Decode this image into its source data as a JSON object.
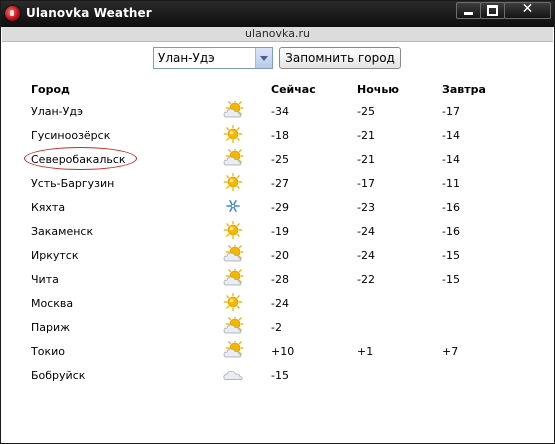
{
  "window": {
    "title": "Ulanovka Weather"
  },
  "url": "ulanovka.ru",
  "controls": {
    "city_select": {
      "value": "Улан-Удэ"
    },
    "remember_button": "Запомнить город"
  },
  "table": {
    "headers": {
      "city": "Город",
      "now": "Сейчас",
      "night": "Ночью",
      "tomorrow": "Завтра"
    },
    "rows": [
      {
        "city": "Улан-Удэ",
        "icon": "partly-cloudy-icon",
        "now": "-34",
        "night": "-25",
        "tomorrow": "-17"
      },
      {
        "city": "Гусиноозёрск",
        "icon": "sun-icon",
        "now": "-18",
        "night": "-21",
        "tomorrow": "-14"
      },
      {
        "city": "Северобакальск",
        "icon": "partly-cloudy-icon",
        "now": "-25",
        "night": "-21",
        "tomorrow": "-14",
        "highlighted": true
      },
      {
        "city": "Усть-Баргузин",
        "icon": "sun-icon",
        "now": "-27",
        "night": "-17",
        "tomorrow": "-11"
      },
      {
        "city": "Кяхта",
        "icon": "snowflake-icon",
        "now": "-29",
        "night": "-23",
        "tomorrow": "-16"
      },
      {
        "city": "Закаменск",
        "icon": "sun-icon",
        "now": "-19",
        "night": "-24",
        "tomorrow": "-16"
      },
      {
        "city": "Иркутск",
        "icon": "partly-cloudy-icon",
        "now": "-20",
        "night": "-24",
        "tomorrow": "-15"
      },
      {
        "city": "Чита",
        "icon": "partly-cloudy-icon",
        "now": "-28",
        "night": "-22",
        "tomorrow": "-15"
      },
      {
        "city": "Москва",
        "icon": "sun-icon",
        "now": "-24",
        "night": "",
        "tomorrow": ""
      },
      {
        "city": "Париж",
        "icon": "partly-cloudy-icon",
        "now": "-2",
        "night": "",
        "tomorrow": ""
      },
      {
        "city": "Токио",
        "icon": "partly-cloudy-icon",
        "now": "+10",
        "night": "+1",
        "tomorrow": "+7"
      },
      {
        "city": "Бобруйск",
        "icon": "cloud-icon",
        "now": "-15",
        "night": "",
        "tomorrow": ""
      }
    ]
  },
  "colors": {
    "titlebar": "#111111",
    "highlight_ring": "#c8281e",
    "sun": "#f5b800",
    "cloud": "#e9ecf1",
    "snow": "#3f86d6"
  }
}
